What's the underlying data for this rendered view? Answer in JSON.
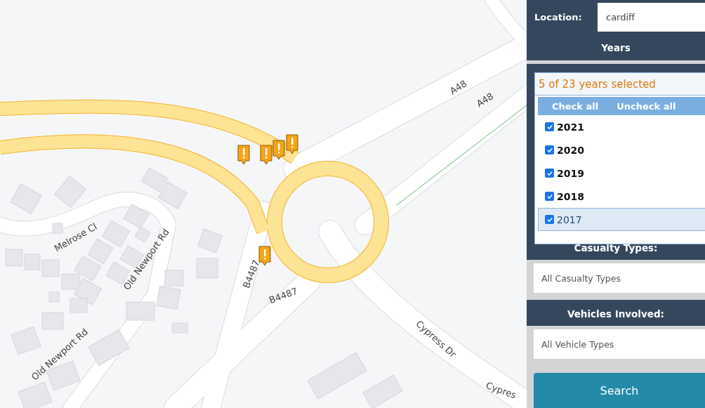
{
  "map": {
    "road_labels": [
      {
        "text": "A48"
      },
      {
        "text": "A48"
      },
      {
        "text": "Melrose Cl"
      },
      {
        "text": "Old Newport Rd"
      },
      {
        "text": "Old Newport Rd"
      },
      {
        "text": "B4487"
      },
      {
        "text": "B4487"
      },
      {
        "text": "Cypress Dr"
      },
      {
        "text": "Cypres"
      }
    ]
  },
  "filters": {
    "location": {
      "label": "Location:",
      "value": "cardiff"
    },
    "years": {
      "title": "Years",
      "summary": "5 of 23 years selected",
      "check_all": "Check all",
      "uncheck_all": "Uncheck all",
      "options": [
        {
          "label": "2021",
          "checked": true,
          "selected": false
        },
        {
          "label": "2020",
          "checked": true,
          "selected": false
        },
        {
          "label": "2019",
          "checked": true,
          "selected": false
        },
        {
          "label": "2018",
          "checked": true,
          "selected": false
        },
        {
          "label": "2017",
          "checked": true,
          "selected": true
        }
      ]
    },
    "casualty": {
      "title": "Casualty Types:",
      "value": "All Casualty Types"
    },
    "vehicles": {
      "title": "Vehicles Involved:",
      "value": "All Vehicle Types"
    },
    "search_button": "Search"
  }
}
